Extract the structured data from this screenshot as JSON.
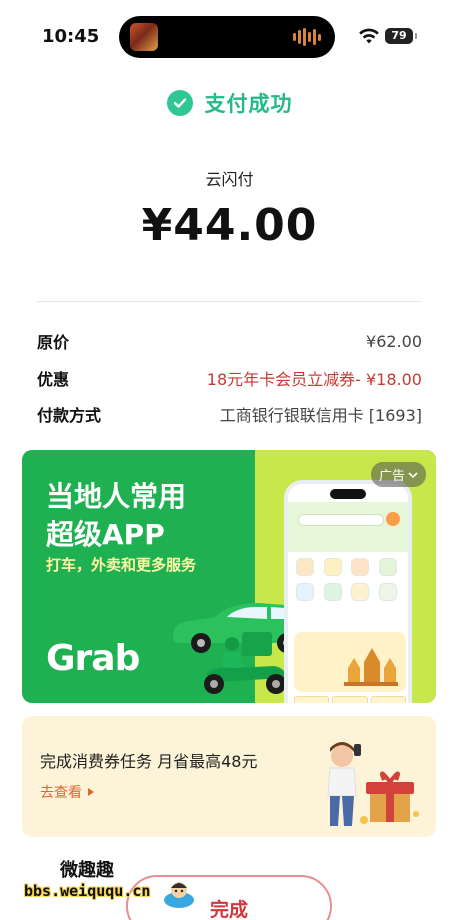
{
  "status_bar": {
    "time": "10:45",
    "battery": "79"
  },
  "result": {
    "status_text": "支付成功",
    "pay_channel": "云闪付",
    "amount": "¥44.00"
  },
  "details": [
    {
      "label": "原价",
      "value": "¥62.00",
      "highlight": false
    },
    {
      "label": "优惠",
      "value": "18元年卡会员立减券- ¥18.00",
      "highlight": true
    },
    {
      "label": "付款方式",
      "value": "工商银行银联信用卡 [1693]",
      "highlight": false
    }
  ],
  "ad": {
    "badge": "广告",
    "title_line1": "当地人常用",
    "title_line2": "超级APP",
    "subtitle": "打车，外卖和更多服务",
    "brand": "Grab"
  },
  "task": {
    "title": "完成消费券任务 月省最高48元",
    "link": "去查看"
  },
  "done_button": "完成",
  "watermark": {
    "name": "微趣趣",
    "url": "bbs.weiququ.cn"
  },
  "colors": {
    "success": "#23b988",
    "discount": "#c73a35",
    "grab_green": "#1fb052",
    "button_red": "#d2363c"
  }
}
